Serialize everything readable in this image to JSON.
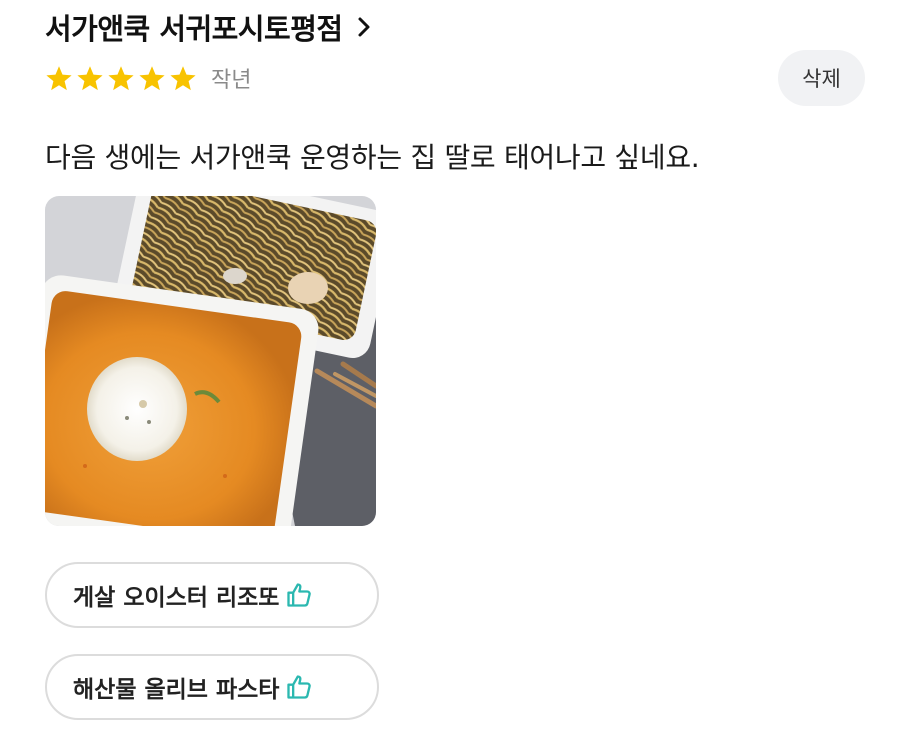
{
  "store": {
    "name": "서가앤쿡 서귀포시토평점",
    "chevron_icon": "chevron-right-icon"
  },
  "review": {
    "rating": 5,
    "rating_max": 5,
    "date": "작년",
    "text": "다음 생에는 서가앤쿡 운영하는 집 딸로 태어나고 싶네요.",
    "delete_label": "삭제"
  },
  "menu_tags": [
    {
      "label": "게살 오이스터 리조또",
      "icon": "thumbs-up-icon"
    },
    {
      "label": "해산물 올리브 파스타",
      "icon": "thumbs-up-icon"
    }
  ],
  "colors": {
    "star": "#f8c300",
    "thumb_icon": "#2bb8b0",
    "date_text": "#8a8a8a",
    "delete_bg": "#f1f2f4",
    "chip_border": "#dcdcdc"
  }
}
